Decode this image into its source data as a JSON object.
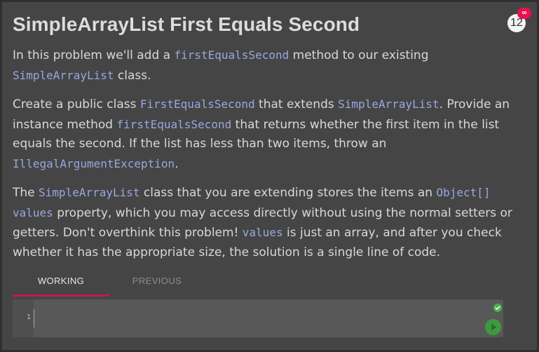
{
  "header": {
    "title": "SimpleArrayList First Equals Second",
    "badge_count": "12",
    "badge_indicator": "∞"
  },
  "paragraphs": {
    "p1": {
      "t1": "In this problem we'll add a ",
      "c1": "firstEqualsSecond",
      "t2": " method to our existing ",
      "c2": "SimpleArrayList",
      "t3": " class."
    },
    "p2": {
      "t1": "Create a public class ",
      "c1": "FirstEqualsSecond",
      "t2": " that extends ",
      "c2": "SimpleArrayList",
      "t3": ". Provide an instance method ",
      "c3": "firstEqualsSecond",
      "t4": " that returns whether the first item in the list equals the second. If the list has less than two items, throw an ",
      "c4": "IllegalArgumentException",
      "t5": "."
    },
    "p3": {
      "t1": "The ",
      "c1": "SimpleArrayList",
      "t2": " class that you are extending stores the items an ",
      "c2": "Object[]",
      "t3": " ",
      "c3": "values",
      "t4": " property, which you may access directly without using the normal setters or getters. Don't overthink this problem! ",
      "c4": "values",
      "t5": " is just an array, and after you check whether it has the appropriate size, the solution is a single line of code."
    }
  },
  "tabs": [
    {
      "label": "WORKING",
      "active": true
    },
    {
      "label": "PREVIOUS",
      "active": false
    }
  ],
  "editor": {
    "line_number": "1",
    "code": ""
  },
  "colors": {
    "accent": "#c2185b",
    "badge": "#e8104f",
    "code_text": "#9aa7e0",
    "status_ok": "#4caf50",
    "run_button": "#3e9a3e"
  },
  "icons": {
    "status": "check-circle-icon",
    "run": "play-icon"
  }
}
